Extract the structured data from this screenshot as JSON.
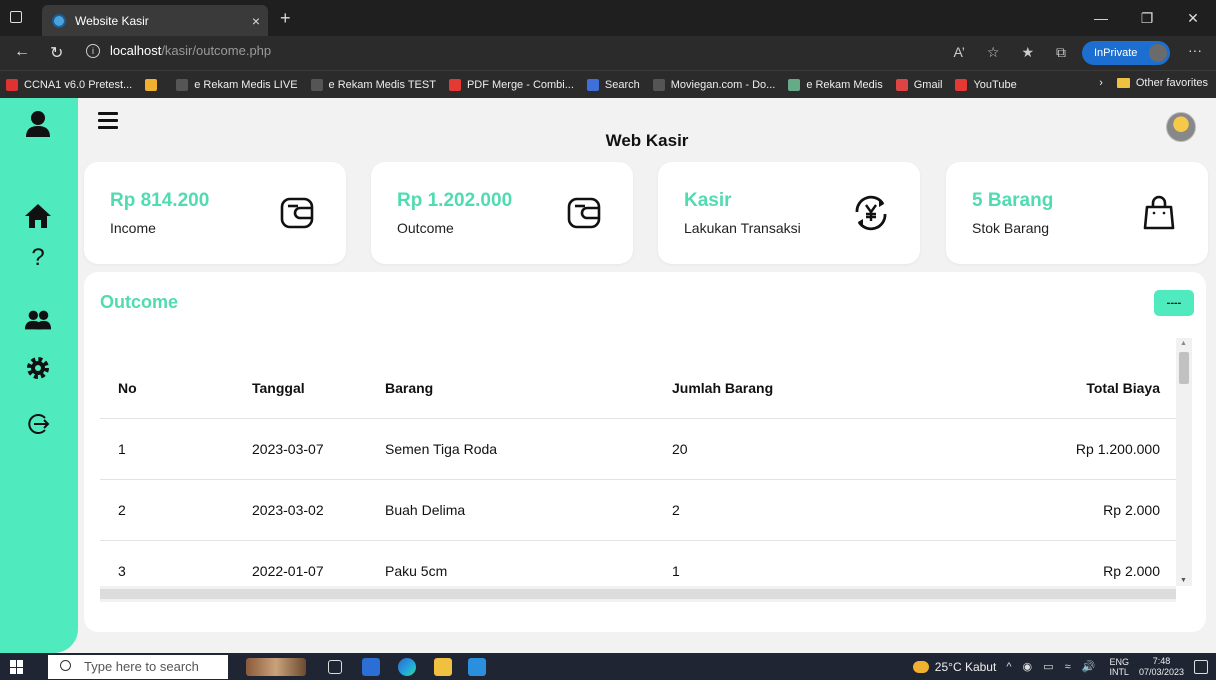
{
  "browser": {
    "tab_title": "Website Kasir",
    "tab_close": "×",
    "new_tab": "+",
    "url_host": "localhost",
    "url_path": "/kasir/outcome.php",
    "inprivate_label": "InPrivate",
    "more_label": "···",
    "bookmarks": [
      {
        "label": "CCNA1 v6.0 Pretest...",
        "color": "#d33"
      },
      {
        "label": "",
        "color": "#f0b030"
      },
      {
        "label": "e Rekam Medis LIVE",
        "color": "#555"
      },
      {
        "label": "e Rekam Medis TEST",
        "color": "#555"
      },
      {
        "label": "PDF Merge - Combi...",
        "color": "#e53935"
      },
      {
        "label": "Search",
        "color": "#3f6fd8"
      },
      {
        "label": "Moviegan.com - Do...",
        "color": "#555"
      },
      {
        "label": "e Rekam Medis",
        "color": "#6a8"
      },
      {
        "label": "Gmail",
        "color": "#d44"
      },
      {
        "label": "YouTube",
        "color": "#e53935"
      }
    ],
    "other_favorites": "Other favorites"
  },
  "app": {
    "title": "Web Kasir",
    "accent_color": "#50eabf"
  },
  "cards": [
    {
      "value": "Rp 814.200",
      "label": "Income",
      "icon": "wallet-icon"
    },
    {
      "value": "Rp 1.202.000",
      "label": "Outcome",
      "icon": "wallet-icon"
    },
    {
      "value": "Kasir",
      "label": "Lakukan Transaksi",
      "icon": "yen-exchange-icon"
    },
    {
      "value": "5 Barang",
      "label": "Stok Barang",
      "icon": "shopping-bag-icon"
    }
  ],
  "outcome": {
    "title": "Outcome",
    "button_label": "----",
    "columns": [
      "No",
      "Tanggal",
      "Barang",
      "Jumlah Barang",
      "Total Biaya"
    ],
    "rows": [
      [
        "1",
        "2023-03-07",
        "Semen Tiga Roda",
        "20",
        "Rp 1.200.000"
      ],
      [
        "2",
        "2023-03-02",
        "Buah Delima",
        "2",
        "Rp 2.000"
      ],
      [
        "3",
        "2022-01-07",
        "Paku 5cm",
        "1",
        "Rp 2.000"
      ]
    ]
  },
  "taskbar": {
    "search_placeholder": "Type here to search",
    "weather": "25°C Kabut",
    "lang_line1": "ENG",
    "lang_line2": "INTL",
    "time": "7:48",
    "date": "07/03/2023"
  }
}
